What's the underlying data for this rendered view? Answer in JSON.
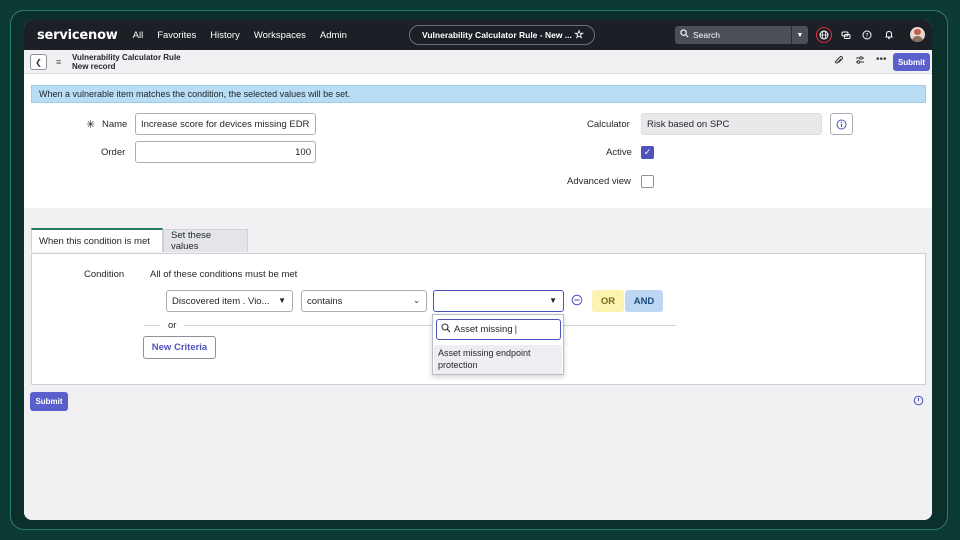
{
  "nav": {
    "logo": "servicenow",
    "items": [
      "All",
      "Favorites",
      "History",
      "Workspaces",
      "Admin"
    ],
    "context_pill": "Vulnerability Calculator Rule - New ...",
    "search_placeholder": "Search"
  },
  "record": {
    "title": "Vulnerability Calculator Rule",
    "subtitle": "New record",
    "submit_label": "Submit"
  },
  "info": {
    "message": "When a vulnerable item matches the condition, the selected values will be set."
  },
  "form": {
    "name_label": "Name",
    "name_value": "Increase score for devices missing EDR",
    "order_label": "Order",
    "order_value": "100",
    "calculator_label": "Calculator",
    "calculator_value": "Risk based on SPC",
    "active_label": "Active",
    "active_checked": true,
    "advanced_label": "Advanced view",
    "advanced_checked": false,
    "required_mark": "✳"
  },
  "tabs": [
    {
      "label": "When this condition is met",
      "active": true
    },
    {
      "label": "Set these values",
      "active": false
    }
  ],
  "condition": {
    "label": "Condition",
    "header": "All of these conditions must be met",
    "field": "Discovered item . Vio...",
    "operator": "contains",
    "value": "",
    "or_label": "OR",
    "and_label": "AND",
    "separator": "or",
    "new_criteria": "New Criteria"
  },
  "dropdown": {
    "search_text": "Asset missing",
    "option": "Asset missing endpoint protection"
  },
  "footer": {
    "submit_label": "Submit"
  },
  "colors": {
    "brand_header": "#1c1f26",
    "accent": "#5a5fcb",
    "info_bg": "#b9ddf5",
    "or_bg": "#fdf3b0",
    "and_bg": "#bcd6f3"
  }
}
